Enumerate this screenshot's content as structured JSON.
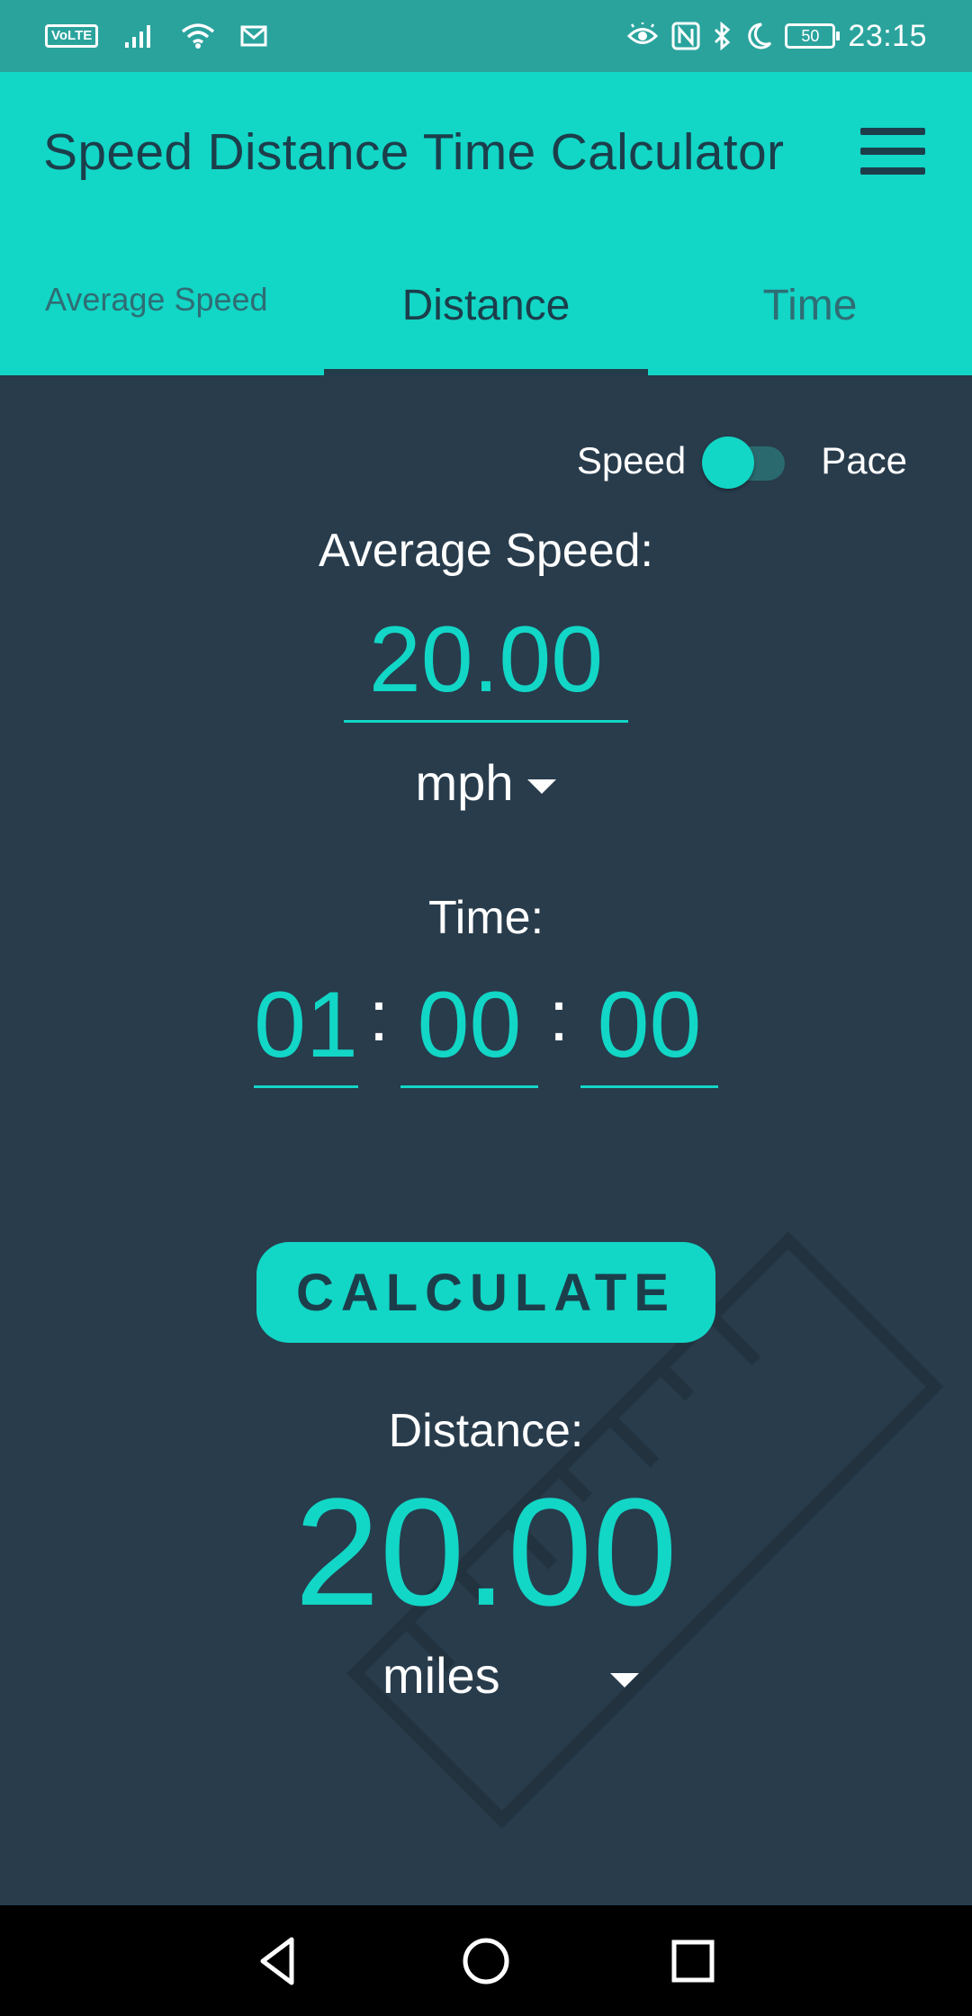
{
  "status_bar": {
    "volte": "VoLTE",
    "battery": "50",
    "time": "23:15",
    "icons": [
      "signal-icon",
      "wifi-icon",
      "mail-icon",
      "eye-icon",
      "nfc-icon",
      "bluetooth-icon",
      "moon-icon",
      "battery-icon"
    ]
  },
  "app_bar": {
    "title": "Speed Distance Time Calculator",
    "menu_icon": "hamburger-menu-icon"
  },
  "tabs": [
    {
      "label": "Average Speed",
      "selected": false
    },
    {
      "label": "Distance",
      "selected": true
    },
    {
      "label": "Time",
      "selected": false
    }
  ],
  "mode_toggle": {
    "left_label": "Speed",
    "right_label": "Pace",
    "selected": "Speed"
  },
  "speed": {
    "label": "Average Speed:",
    "value": "20.00",
    "unit": "mph"
  },
  "time": {
    "label": "Time:",
    "hours": "01",
    "minutes": "00",
    "seconds": "00",
    "separator": ":"
  },
  "calculate_label": "CALCULATE",
  "result": {
    "label": "Distance:",
    "value": "20.00",
    "unit": "miles"
  },
  "colors": {
    "accent": "#12d6c6",
    "status_bar": "#2aa39d",
    "background": "#283c4c",
    "app_bar_text": "#1c3e4b"
  },
  "nav_bar": {
    "icons": [
      "back-icon",
      "home-icon",
      "recents-icon"
    ]
  }
}
